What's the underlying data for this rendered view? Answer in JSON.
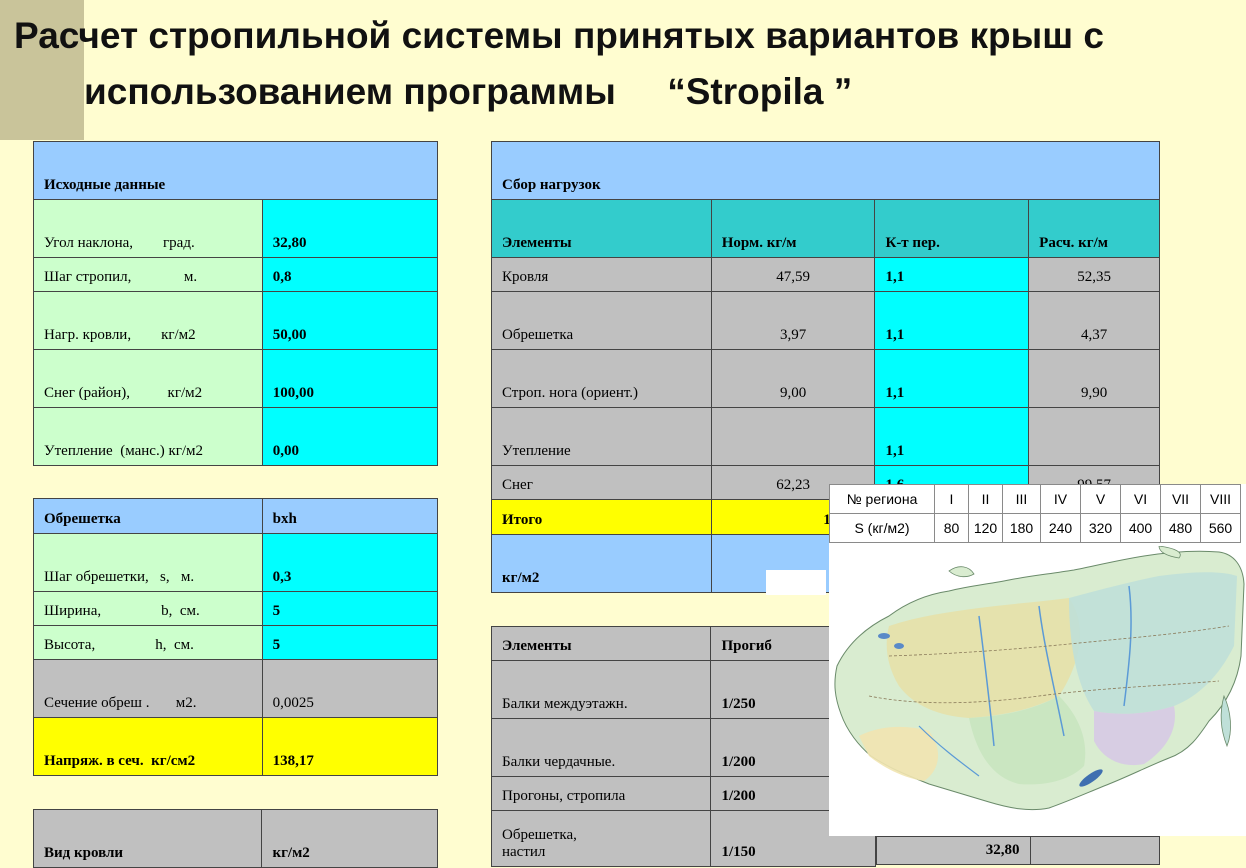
{
  "title": {
    "line1": "Расчет стропильной системы принятых вариантов крыш с",
    "line2": "использованием программы     “Stropila ”"
  },
  "source_data": {
    "header": "Исходные данные",
    "rows": [
      {
        "label": "Угол наклона,        град.",
        "value": "32,80"
      },
      {
        "label": "Шаг стропил,              м.",
        "value": "0,8"
      },
      {
        "label": "Нагр. кровли,        кг/м2",
        "value": "50,00"
      },
      {
        "label": "Снег (район),          кг/м2",
        "value": "100,00"
      },
      {
        "label": "Утепление  (манс.) кг/м2",
        "value": "0,00"
      }
    ]
  },
  "lathing": {
    "header_label": "Обрешетка",
    "header_value": "bxh",
    "rows": [
      {
        "label": "Шаг обрешетки,   s,   м.",
        "value": "0,3"
      },
      {
        "label": "Ширина,                b,  см.",
        "value": "5"
      },
      {
        "label": "Высота,                h,  см.",
        "value": "5"
      },
      {
        "label": "Сечение обреш .       м2.",
        "value": "0,0025"
      },
      {
        "label": "Напряж. в сеч.  кг/см2",
        "value": "138,17"
      }
    ]
  },
  "roof_type": {
    "label": "Вид кровли",
    "value": "кг/м2"
  },
  "loads": {
    "header": "Сбор нагрузок",
    "columns": [
      "Элементы",
      "Норм. кг/м",
      "К-т пер.",
      "Расч. кг/м"
    ],
    "rows": [
      {
        "name": "Кровля",
        "norm": "47,59",
        "k": "1,1",
        "calc": "52,35"
      },
      {
        "name": "Обрешетка",
        "norm": "3,97",
        "k": "1,1",
        "calc": "4,37"
      },
      {
        "name": "Строп. нога (ориент.)",
        "norm": "9,00",
        "k": "1,1",
        "calc": "9,90"
      },
      {
        "name": "Утепление",
        "norm": "",
        "k": "1,1",
        "calc": ""
      },
      {
        "name": "Снег",
        "norm": "62,23",
        "k": "1,6",
        "calc": "99,57"
      }
    ],
    "total": {
      "label": "Итого",
      "value": "122,79"
    },
    "unit_label": "кг/м2"
  },
  "deflection": {
    "columns": [
      "Элементы",
      "Прогиб"
    ],
    "rows": [
      {
        "name": "Балки междуэтажн.",
        "value": "1/250"
      },
      {
        "name": "Балки чердачные.",
        "value": "1/200"
      },
      {
        "name": "Прогоны, стропила",
        "value": "1/200"
      },
      {
        "name_line1": "Обрешетка,",
        "name_line2": "настил",
        "value": "1/150",
        "extra": "32,80"
      }
    ]
  },
  "snow_legend": {
    "region_label": "№ региона",
    "load_label": "S (кг/м2)",
    "regions": [
      "I",
      "II",
      "III",
      "IV",
      "V",
      "VI",
      "VII",
      "VIII"
    ],
    "loads": [
      "80",
      "120",
      "180",
      "240",
      "320",
      "400",
      "480",
      "560"
    ]
  }
}
